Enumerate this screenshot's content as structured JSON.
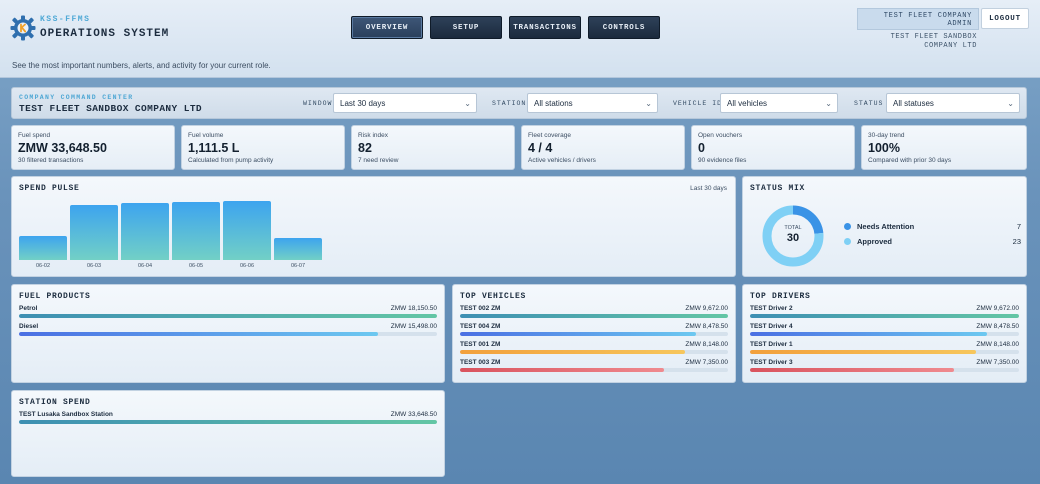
{
  "header": {
    "brand_sub": "KSS-FFMS",
    "brand_title": "OPERATIONS SYSTEM",
    "tagline": "See the most important numbers, alerts, and activity for your current role.",
    "nav": [
      {
        "label": "OVERVIEW",
        "active": true
      },
      {
        "label": "SETUP",
        "active": false
      },
      {
        "label": "TRANSACTIONS",
        "active": false
      },
      {
        "label": "CONTROLS",
        "active": false
      }
    ],
    "user_label": "TEST FLEET COMPANY ADMIN",
    "user_company": "TEST FLEET SANDBOX COMPANY LTD",
    "logout_label": "LOGOUT"
  },
  "filters": {
    "subtitle": "COMPANY COMMAND CENTER",
    "company": "TEST FLEET SANDBOX COMPANY LTD",
    "window_label": "WINDOW",
    "window_value": "Last 30 days",
    "station_label": "STATION",
    "station_value": "All stations",
    "vehicle_label": "VEHICLE ID",
    "vehicle_value": "All vehicles",
    "status_label": "STATUS",
    "status_value": "All statuses"
  },
  "kpis": [
    {
      "label": "Fuel spend",
      "value": "ZMW 33,648.50",
      "note": "30 filtered transactions"
    },
    {
      "label": "Fuel volume",
      "value": "1,111.5 L",
      "note": "Calculated from pump activity"
    },
    {
      "label": "Risk index",
      "value": "82",
      "note": "7 need review"
    },
    {
      "label": "Fleet coverage",
      "value": "4 / 4",
      "note": "Active vehicles / drivers"
    },
    {
      "label": "Open vouchers",
      "value": "0",
      "note": "90 evidence files"
    },
    {
      "label": "30-day trend",
      "value": "100%",
      "note": "Compared with prior 30 days"
    }
  ],
  "spend_pulse": {
    "title": "SPEND PULSE",
    "range": "Last 30 days"
  },
  "chart_data": {
    "type": "bar",
    "categories": [
      "06-02",
      "06-03",
      "06-04",
      "06-05",
      "06-06",
      "06-07"
    ],
    "values": [
      0.34,
      0.79,
      0.82,
      0.83,
      0.84,
      0.31
    ],
    "colors": {
      "bar_top": "#3da4ef",
      "bar_bottom": "#72d0c6"
    }
  },
  "status_mix": {
    "title": "STATUS MIX",
    "total_label": "TOTAL",
    "total": "30",
    "items": [
      {
        "label": "Needs Attention",
        "count": "7",
        "value": 7,
        "color": "#3a93e6"
      },
      {
        "label": "Approved",
        "count": "23",
        "value": 23,
        "color": "#7fd0f5"
      }
    ]
  },
  "fuel_products": {
    "title": "FUEL PRODUCTS",
    "rows": [
      {
        "name": "Petrol",
        "value": "ZMW 18,150.50",
        "pct": 1.0,
        "color": "#3d8fb3,#63c6a5"
      },
      {
        "name": "Diesel",
        "value": "ZMW 15,498.00",
        "pct": 0.86,
        "color": "#4a6fe3,#6cc8f0"
      }
    ]
  },
  "top_vehicles": {
    "title": "TOP VEHICLES",
    "rows": [
      {
        "name": "TEST 002 ZM",
        "value": "ZMW 9,672.00",
        "pct": 1.0,
        "color": "#3d8fb3,#63c6a5"
      },
      {
        "name": "TEST 004 ZM",
        "value": "ZMW 8,478.50",
        "pct": 0.88,
        "color": "#4a6fe3,#6cc8f0"
      },
      {
        "name": "TEST 001 ZM",
        "value": "ZMW 8,148.00",
        "pct": 0.84,
        "color": "#f2a03c,#f6c65c"
      },
      {
        "name": "TEST 003 ZM",
        "value": "ZMW 7,350.00",
        "pct": 0.76,
        "color": "#d9535e,#ef8a8f"
      }
    ]
  },
  "top_drivers": {
    "title": "TOP DRIVERS",
    "rows": [
      {
        "name": "TEST Driver 2",
        "value": "ZMW 9,672.00",
        "pct": 1.0,
        "color": "#3d8fb3,#63c6a5"
      },
      {
        "name": "TEST Driver 4",
        "value": "ZMW 8,478.50",
        "pct": 0.88,
        "color": "#4a6fe3,#6cc8f0"
      },
      {
        "name": "TEST Driver 1",
        "value": "ZMW 8,148.00",
        "pct": 0.84,
        "color": "#f2a03c,#f6c65c"
      },
      {
        "name": "TEST Driver 3",
        "value": "ZMW 7,350.00",
        "pct": 0.76,
        "color": "#d9535e,#ef8a8f"
      }
    ]
  },
  "station_spend": {
    "title": "STATION SPEND",
    "rows": [
      {
        "name": "TEST Lusaka Sandbox Station",
        "value": "ZMW 33,648.50",
        "pct": 1.0,
        "color": "#3d8fb3,#63c6a5"
      }
    ]
  }
}
